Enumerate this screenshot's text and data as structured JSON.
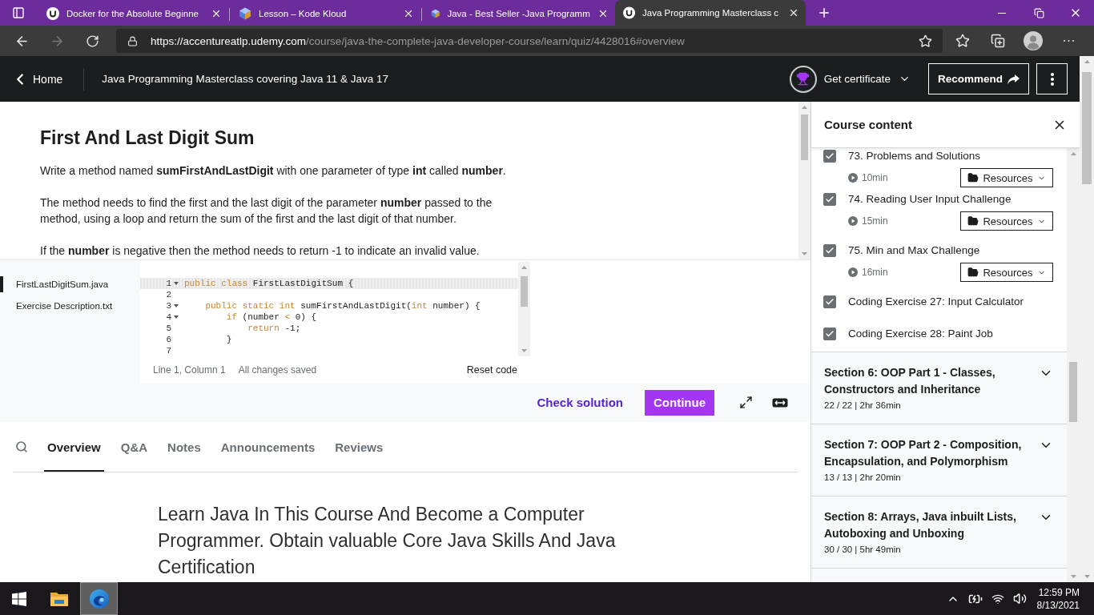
{
  "browser": {
    "tabs": [
      {
        "title": "Docker for the Absolute Beginne",
        "kind": "ring",
        "selected": false
      },
      {
        "title": "Lesson – Kode Kloud",
        "kind": "cube",
        "selected": false
      },
      {
        "title": "Java - Best Seller -Java Programm",
        "kind": "cube",
        "selected": false
      },
      {
        "title": "Java Programming Masterclass c",
        "kind": "ring",
        "selected": true
      }
    ],
    "forward_disabled": true,
    "url": {
      "origin": "https://accentureatlp.udemy.com",
      "path": "/course/java-the-complete-java-developer-course/learn/quiz/4428016#overview"
    }
  },
  "header": {
    "home": "Home",
    "course_title": "Java Programming Masterclass covering Java 11 & Java 17",
    "certificate": "Get certificate",
    "recommend": "Recommend"
  },
  "exercise": {
    "title": "First And Last Digit Sum",
    "paragraphs": [
      "Write a method named **sumFirstAndLastDigit** with one parameter of type **int** called **number**.",
      "The method needs to find the first and the last digit of the parameter **number** passed to the method, using a loop and return the sum of the first and the last digit of that number.",
      "If the **number** is negative then the method needs to return -1 to indicate an invalid value."
    ]
  },
  "editor": {
    "files": [
      {
        "name": "FirstLastDigitSum.java",
        "selected": true
      },
      {
        "name": "Exercise Description.txt",
        "selected": false
      }
    ],
    "lines": [
      {
        "number": "1",
        "foldable": true,
        "current": true,
        "tokens": [
          {
            "text": "public class",
            "kind": "keyword"
          },
          {
            "text": " FirstLastDigitSum {",
            "kind": "plain"
          }
        ]
      },
      {
        "number": "2",
        "foldable": false,
        "current": false
      },
      {
        "number": "3",
        "foldable": true,
        "current": false,
        "tokens": [
          {
            "text": "    public static int",
            "kind": "keyword"
          },
          {
            "text": " sumFirstAndLastDigit(",
            "kind": "plain"
          },
          {
            "text": "int",
            "kind": "keyword"
          },
          {
            "text": " number) {",
            "kind": "plain"
          }
        ]
      },
      {
        "number": "4",
        "foldable": true,
        "current": false,
        "tokens": [
          {
            "text": "        if",
            "kind": "keyword"
          },
          {
            "text": " (number ",
            "kind": "plain"
          },
          {
            "text": "<",
            "kind": "keyword"
          },
          {
            "text": " 0) {",
            "kind": "plain"
          }
        ]
      },
      {
        "number": "5",
        "foldable": false,
        "current": false,
        "tokens": [
          {
            "text": "            return",
            "kind": "keyword"
          },
          {
            "text": " -1;",
            "kind": "plain"
          }
        ]
      },
      {
        "number": "6",
        "foldable": false,
        "current": false,
        "tokens": [
          {
            "text": "        }",
            "kind": "plain"
          }
        ]
      },
      {
        "number": "7",
        "foldable": false,
        "current": false
      }
    ],
    "position": "Line 1, Column 1",
    "save_state": "All changes saved",
    "reset": "Reset code"
  },
  "actions": {
    "check": "Check solution",
    "continue": "Continue"
  },
  "tabs": [
    {
      "label": "Overview",
      "selected": true
    },
    {
      "label": "Q&A",
      "selected": false
    },
    {
      "label": "Notes",
      "selected": false
    },
    {
      "label": "Announcements",
      "selected": false
    },
    {
      "label": "Reviews",
      "selected": false
    }
  ],
  "overview": {
    "headline": "Learn Java In This Course And Become a Computer Programmer. Obtain valuable Core Java Skills And Java Certification"
  },
  "sidebar": {
    "title": "Course content",
    "items": [
      {
        "kind": "lecture",
        "title": "73. Problems and Solutions",
        "checked": true,
        "duration": "10min",
        "resources": "Resources"
      },
      {
        "kind": "lecture",
        "title": "74. Reading User Input Challenge",
        "checked": true,
        "duration": "15min",
        "resources": "Resources"
      },
      {
        "kind": "lecture",
        "title": "75. Min and Max Challenge",
        "checked": true,
        "duration": "16min",
        "resources": "Resources"
      },
      {
        "kind": "exercise",
        "title": "Coding Exercise 27: Input Calculator",
        "checked": true
      },
      {
        "kind": "exercise",
        "title": "Coding Exercise 28: Paint Job",
        "checked": true
      }
    ],
    "sections": [
      {
        "title": "Section 6: OOP Part 1 - Classes, Constructors and Inheritance",
        "summary": "22 / 22 | 2hr 36min",
        "expanded": false
      },
      {
        "title": "Section 7: OOP Part 2 - Composition, Encapsulation, and Polymorphism",
        "summary": "13 / 13 | 2hr 20min",
        "expanded": false
      },
      {
        "title": "Section 8: Arrays, Java inbuilt Lists, Autoboxing and Unboxing",
        "summary": "30 / 30 | 5hr 49min",
        "expanded": false
      }
    ]
  },
  "taskbar": {
    "apps": [
      {
        "kind": "folder",
        "selected": false
      },
      {
        "kind": "swirl",
        "selected": true
      }
    ],
    "time": "12:59 PM",
    "date": "8/13/2021"
  }
}
